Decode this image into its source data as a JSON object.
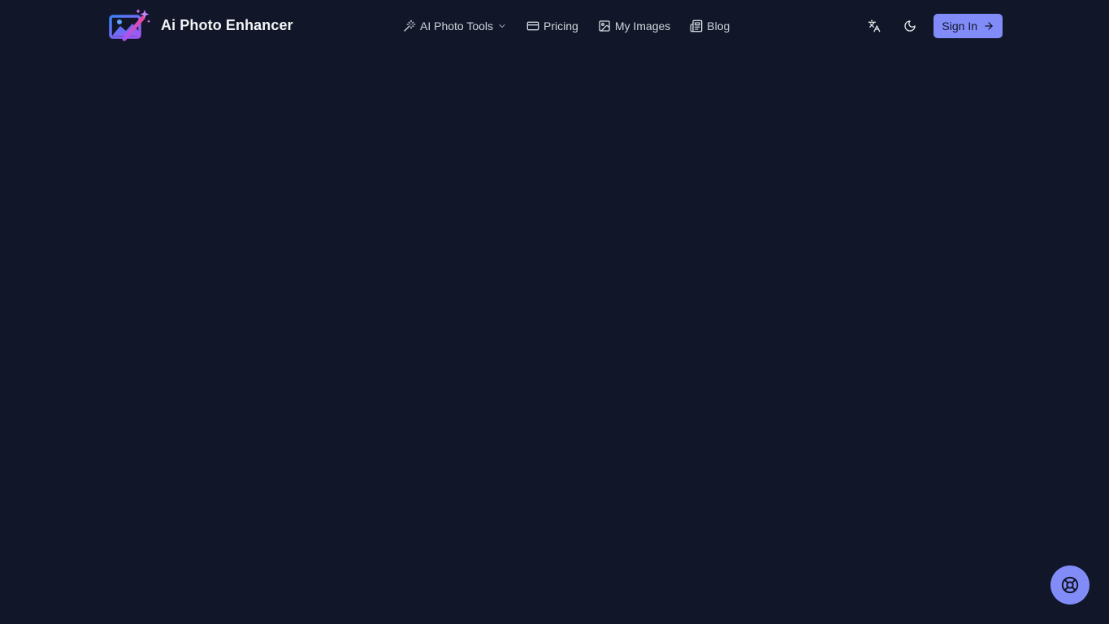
{
  "brand": {
    "name": "Ai Photo Enhancer",
    "logo_icon": "photo-magic-wand-logo"
  },
  "nav": {
    "items": [
      {
        "label": "AI Photo Tools",
        "icon": "magic-wand-icon",
        "has_dropdown": true
      },
      {
        "label": "Pricing",
        "icon": "credit-card-icon"
      },
      {
        "label": "My Images",
        "icon": "image-icon"
      },
      {
        "label": "Blog",
        "icon": "newspaper-icon"
      }
    ]
  },
  "toolbar": {
    "language_icon": "translate-icon",
    "theme_icon": "moon-icon",
    "signin_label": "Sign In",
    "signin_icon": "arrow-right-icon"
  },
  "help": {
    "icon": "lifebuoy-icon"
  },
  "colors": {
    "background": "#111729",
    "accent": "#818cf8",
    "text": "#d1d5db"
  }
}
